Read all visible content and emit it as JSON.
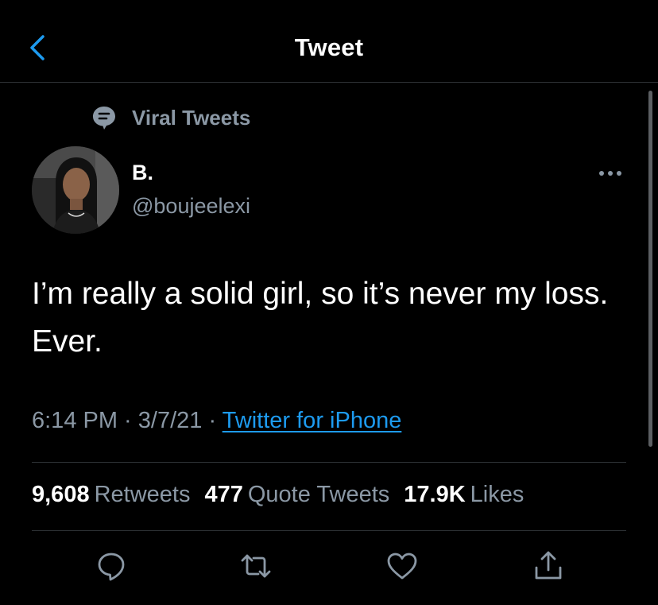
{
  "header": {
    "title": "Tweet",
    "back_icon": "chevron-left-icon"
  },
  "colors": {
    "accent": "#1d9bf0",
    "secondary_text": "#8b98a5",
    "divider": "#2f3336",
    "background": "#000000"
  },
  "tweet": {
    "topic": {
      "label": "Viral Tweets",
      "icon": "topic-speech-bubble-icon"
    },
    "author": {
      "display_name": "B.",
      "handle": "@boujeelexi",
      "avatar": "avatar"
    },
    "more_icon": "more-horizontal-icon",
    "text": "I’m really a solid girl, so it’s never my loss. Ever.",
    "meta": {
      "time": "6:14 PM",
      "separator1": " · ",
      "date": "3/7/21",
      "separator2": " · ",
      "source": "Twitter for iPhone"
    },
    "stats": {
      "retweets_count": "9,608",
      "retweets_label": "Retweets",
      "quotes_count": "477",
      "quotes_label": "Quote Tweets",
      "likes_count": "17.9K",
      "likes_label": "Likes"
    },
    "actions": [
      {
        "name": "reply",
        "icon": "reply-bubble-icon"
      },
      {
        "name": "retweet",
        "icon": "retweet-icon"
      },
      {
        "name": "like",
        "icon": "heart-icon"
      },
      {
        "name": "share",
        "icon": "share-icon"
      }
    ]
  }
}
